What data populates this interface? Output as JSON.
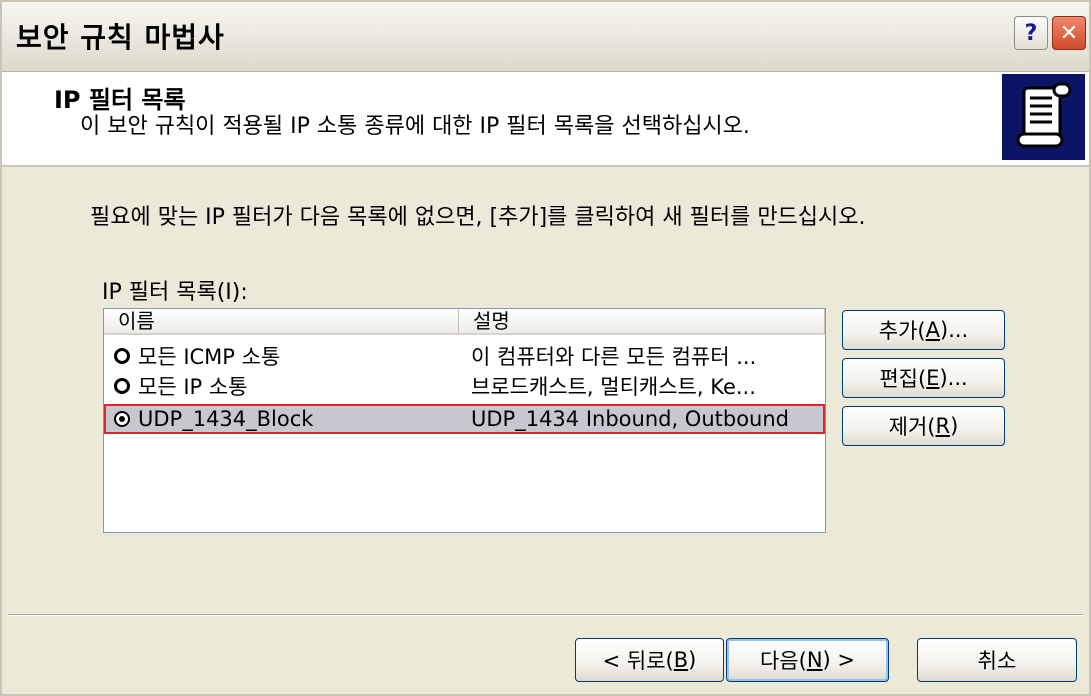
{
  "window": {
    "title": "보안 규칙 마법사",
    "help_label": "?",
    "close_label": "✕"
  },
  "header": {
    "title": "IP 필터 목록",
    "subtitle": "이 보안 규칙이 적용될 IP 소통 종류에 대한 IP 필터 목록을 선택하십시오.",
    "icon": "scroll-document-icon"
  },
  "body": {
    "instructions": "필요에 맞는 IP 필터가 다음 목록에 없으면, [추가]를 클릭하여 새 필터를 만드십시오.",
    "list_label": "IP 필터 목록(I):"
  },
  "list": {
    "columns": [
      "이름",
      "설명"
    ],
    "rows": [
      {
        "name": "모든 ICMP 소통",
        "description": "이 컴퓨터와 다른 모든 컴퓨터 ...",
        "selected": false
      },
      {
        "name": "모든 IP 소통",
        "description": "브로드캐스트, 멀티캐스트, Ke...",
        "selected": false
      },
      {
        "name": "UDP_1434_Block",
        "description": "UDP_1434 Inbound, Outbound",
        "selected": true
      }
    ]
  },
  "side_buttons": {
    "add": {
      "label": "추가(",
      "key": "A",
      "suffix": ")..."
    },
    "edit": {
      "label": "편집(",
      "key": "E",
      "suffix": ")..."
    },
    "remove": {
      "label": "제거(",
      "key": "R",
      "suffix": ")"
    }
  },
  "footer": {
    "back": {
      "label": "< 뒤로(",
      "key": "B",
      "suffix": ")"
    },
    "next": {
      "label": "다음(",
      "key": "N",
      "suffix": ") >"
    },
    "cancel": {
      "label": "취소"
    }
  },
  "colors": {
    "selection_outline": "#e0262a",
    "icon_background": "#0c1466"
  }
}
